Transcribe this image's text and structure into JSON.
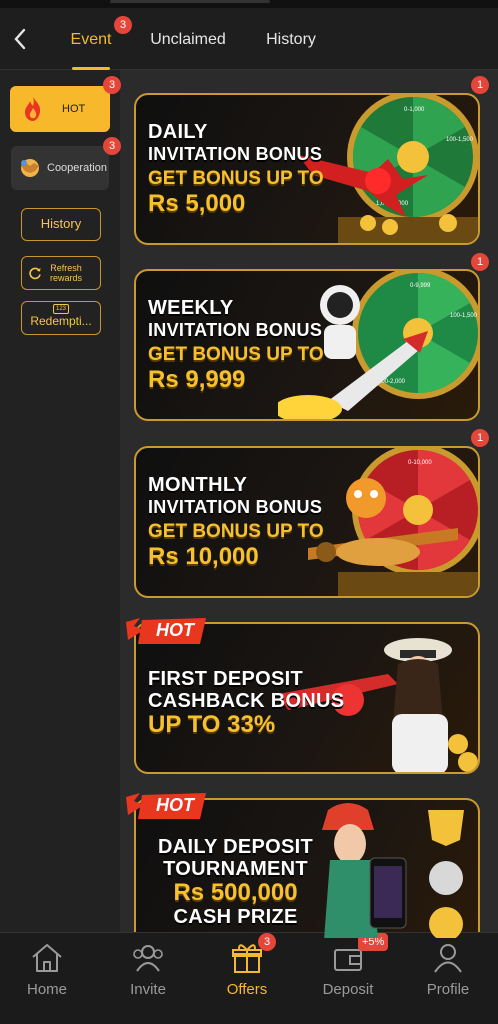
{
  "tabs": [
    {
      "label": "Event",
      "badge": "3"
    },
    {
      "label": "Unclaimed"
    },
    {
      "label": "History"
    }
  ],
  "sidebar": {
    "hot": {
      "label": "HOT",
      "badge": "3"
    },
    "cooperation": {
      "label": "Cooperation",
      "badge": "3"
    },
    "history_label": "History",
    "refresh_label_1": "Refresh",
    "refresh_label_2": "rewards",
    "redemption_label": "Redempti...",
    "redemption_icon_text": "123"
  },
  "banners": [
    {
      "line1": "DAILY",
      "line2": "INVITATION BONUS",
      "line3": "GET BONUS UP TO",
      "line4": "Rs 5,000",
      "badge": "1"
    },
    {
      "line1": "WEEKLY",
      "line2": "INVITATION BONUS",
      "line3": "GET BONUS UP TO",
      "line4": "Rs 9,999",
      "badge": "1"
    },
    {
      "line1": "MONTHLY",
      "line2": "INVITATION BONUS",
      "line3": "GET BONUS UP TO",
      "line4": "Rs 10,000",
      "badge": "1"
    },
    {
      "line1": "FIRST DEPOSIT",
      "line2": "CASHBACK BONUS",
      "line3": "UP TO 33%",
      "tag": "HOT"
    },
    {
      "line1": "DAILY DEPOSIT",
      "line2": "TOURNAMENT",
      "line3": "Rs 500,000",
      "line4": "CASH PRIZE",
      "tag": "HOT"
    }
  ],
  "wheel_labels": {
    "daily": [
      "0-1,000",
      "100-1,500",
      "1,000-2,000"
    ],
    "weekly": [
      "0-9,999",
      "100-1,500",
      "500-2,000"
    ],
    "monthly": [
      "0-10,000"
    ]
  },
  "bottom_nav": [
    {
      "label": "Home",
      "icon": "home-icon"
    },
    {
      "label": "Invite",
      "icon": "invite-icon"
    },
    {
      "label": "Offers",
      "icon": "gift-icon",
      "badge": "3"
    },
    {
      "label": "Deposit",
      "icon": "wallet-icon",
      "badge": "+5%"
    },
    {
      "label": "Profile",
      "icon": "profile-icon"
    }
  ],
  "colors": {
    "accent": "#f5b82e",
    "badge": "#e5463a",
    "banner_border": "#c99a2e"
  }
}
